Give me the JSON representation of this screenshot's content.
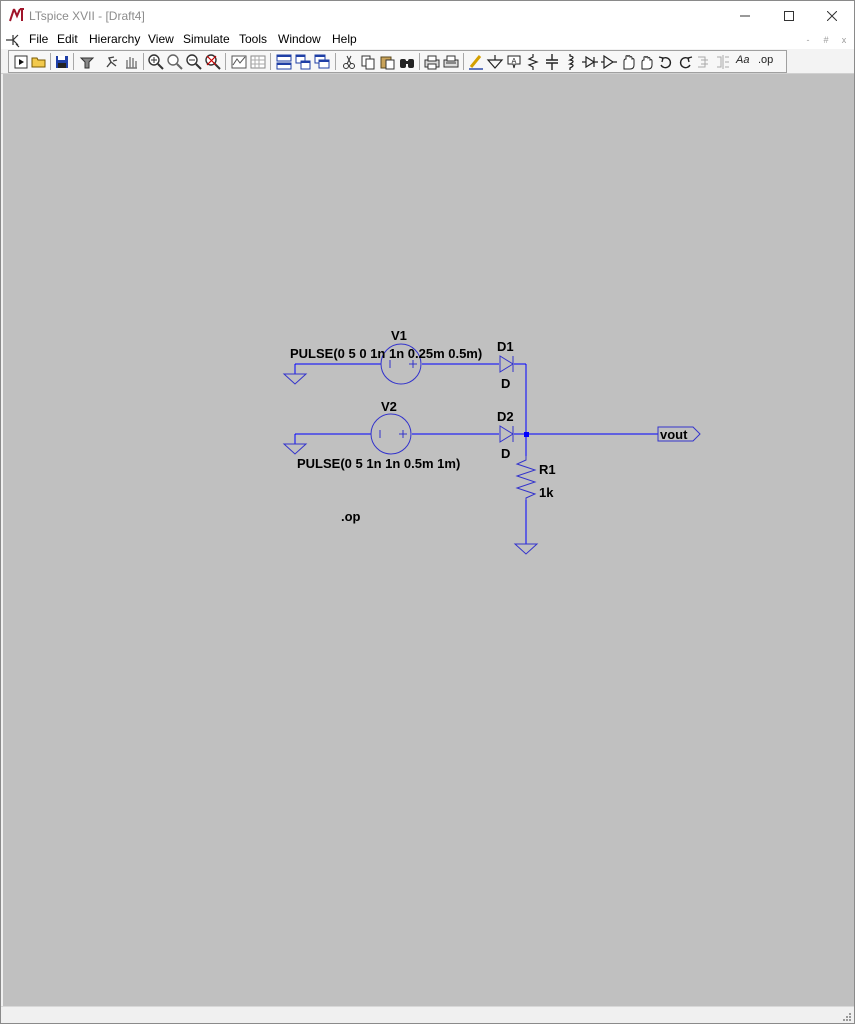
{
  "window": {
    "title": "LTspice XVII - [Draft4]",
    "controls": {
      "minimize": "minimize-icon",
      "maximize": "maximize-icon",
      "close": "close-icon"
    }
  },
  "menu": {
    "items": [
      {
        "label": "File"
      },
      {
        "label": "Edit"
      },
      {
        "label": "Hierarchy"
      },
      {
        "label": "View"
      },
      {
        "label": "Simulate"
      },
      {
        "label": "Tools"
      },
      {
        "label": "Window"
      },
      {
        "label": "Help"
      }
    ],
    "mdi": {
      "minimize": "-",
      "restore": "#",
      "close": "x"
    }
  },
  "toolbar": {
    "buttons": [
      "run-icon",
      "open-icon",
      "save-icon",
      "control-panel-icon",
      "halt-icon",
      "pan-icon",
      "zoom-in-icon",
      "zoom-box-icon",
      "zoom-out-icon",
      "zoom-fit-icon",
      "autorange-icon",
      "grid-icon",
      "tile-horizontal-icon",
      "tile-vertical-icon",
      "cascade-icon",
      "cut-icon",
      "copy-icon",
      "paste-icon",
      "find-icon",
      "print-icon",
      "print-setup-icon",
      "wire-icon",
      "ground-icon",
      "label-net-icon",
      "resistor-icon",
      "capacitor-icon",
      "inductor-icon",
      "diode-icon",
      "component-icon",
      "move-icon",
      "drag-icon",
      "undo-icon",
      "redo-icon",
      "rotate-icon",
      "mirror-icon",
      "text-icon",
      "spice-directive-icon"
    ],
    "text_label": "Aa",
    "op_label": ".op"
  },
  "colors": {
    "canvas": "#c0c0c0",
    "wire": "#0000ff",
    "component": "#3333cc",
    "label": "#000000"
  },
  "schematic": {
    "v1": {
      "name": "V1",
      "value": "PULSE(0 5 0 1n 1n 0.25m 0.5m)"
    },
    "v2": {
      "name": "V2",
      "value": "PULSE(0 5 1n 1n 0.5m 1m)"
    },
    "d1": {
      "name": "D1",
      "model": "D"
    },
    "d2": {
      "name": "D2",
      "model": "D"
    },
    "r1": {
      "name": "R1",
      "value": "1k"
    },
    "net_label": "vout",
    "directive": ".op"
  }
}
